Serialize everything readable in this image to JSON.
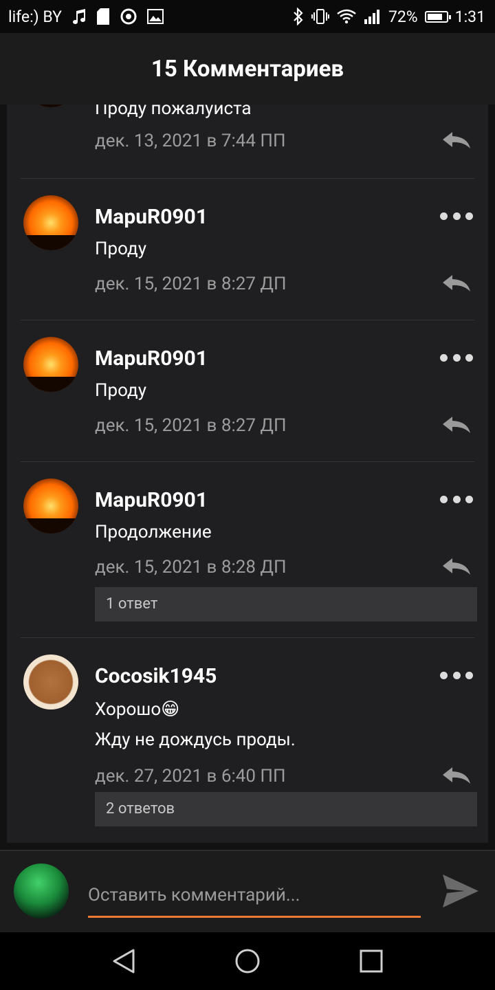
{
  "status_bar": {
    "carrier": "life:) BY",
    "battery": "72%",
    "time": "1:31",
    "icons": [
      "music-icon",
      "sd-card-icon",
      "sync-icon",
      "image-icon",
      "bluetooth-icon",
      "vibrate-icon",
      "wifi-icon",
      "signal-icon",
      "battery-icon"
    ]
  },
  "header": {
    "title": "15 Комментариев"
  },
  "comments": [
    {
      "text": "Проду пожалуиста",
      "date": "дек. 13, 2021 в 7:44 ПП"
    },
    {
      "username": "МарuR0901",
      "text": "Проду",
      "date": "дек. 15, 2021 в 8:27 ДП"
    },
    {
      "username": "МарuR0901",
      "text": "Проду",
      "date": "дек. 15, 2021 в 8:27 ДП"
    },
    {
      "username": "МарuR0901",
      "text": "Продолжение",
      "date": "дек. 15, 2021 в 8:28 ДП",
      "replies": "1 ответ"
    },
    {
      "username": "Cocosik1945",
      "text": "Хорошо😁",
      "text2": "Жду не дождусь проды.",
      "date": "дек. 27, 2021 в 6:40 ПП",
      "replies": "2 ответов"
    }
  ],
  "composer": {
    "placeholder": "Оставить комментарий..."
  },
  "colors": {
    "accent": "#ef7a35",
    "background": "#1f1e21",
    "header": "#1c1c1c"
  }
}
